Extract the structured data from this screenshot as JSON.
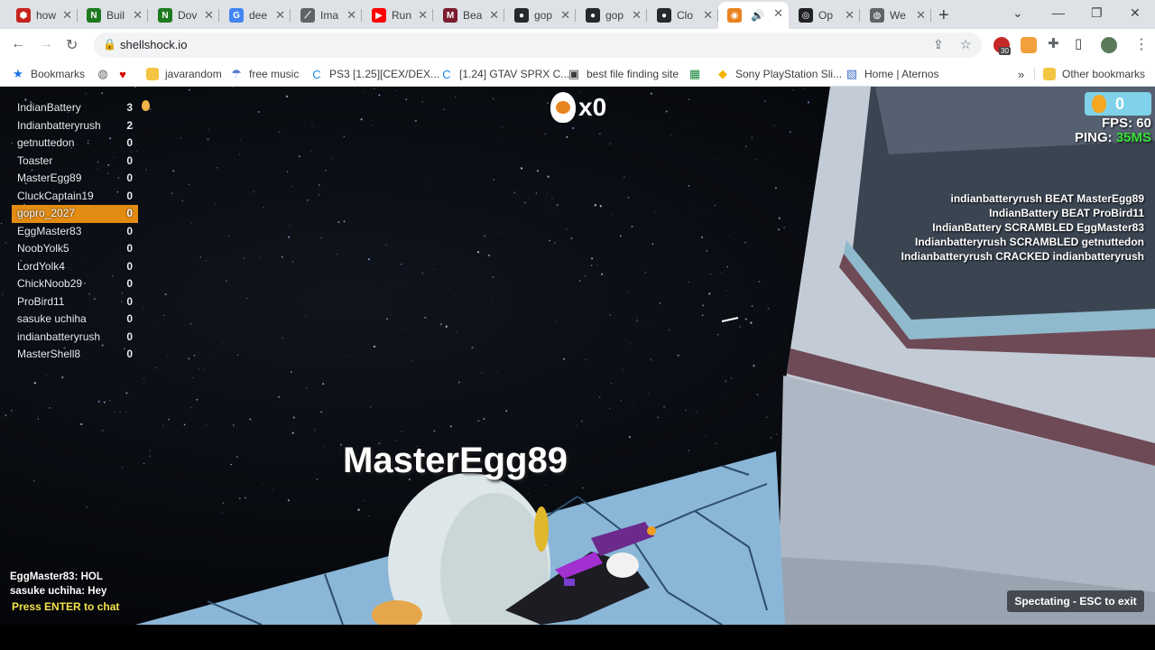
{
  "browser": {
    "tabs": [
      {
        "title": "how",
        "color": "#c5221f",
        "glyph": "⬢"
      },
      {
        "title": "Buil",
        "color": "#1f7a1f",
        "glyph": "N"
      },
      {
        "title": "Dov",
        "color": "#1f7a1f",
        "glyph": "N"
      },
      {
        "title": "dee",
        "color": "#4285f4",
        "glyph": "G"
      },
      {
        "title": "Ima",
        "color": "#5f6368",
        "glyph": "⟋"
      },
      {
        "title": "Run",
        "color": "#ff0000",
        "glyph": "▶"
      },
      {
        "title": "Bea",
        "color": "#7b1c2e",
        "glyph": "M"
      },
      {
        "title": "gop",
        "color": "#24292e",
        "glyph": "●"
      },
      {
        "title": "gop",
        "color": "#24292e",
        "glyph": "●"
      },
      {
        "title": "Clo",
        "color": "#24292e",
        "glyph": "●"
      },
      {
        "title": "",
        "color": "#e8841e",
        "glyph": "◉",
        "active": true
      },
      {
        "title": "Op",
        "color": "#202124",
        "glyph": "◎"
      },
      {
        "title": "We",
        "color": "#5f6368",
        "glyph": "◍"
      }
    ],
    "url": "shellshock.io",
    "extension_badge": "30"
  },
  "bookmarks": [
    {
      "label": "Bookmarks",
      "icon": "star-icon",
      "color": "#1a73e8"
    },
    {
      "label": "",
      "icon": "globe-icon",
      "color": "#5f6368"
    },
    {
      "label": "",
      "icon": "heart-icon",
      "color": "#d50000"
    },
    {
      "label": "javarandom",
      "icon": "folder-icon",
      "color": "#f4c542"
    },
    {
      "label": "free music",
      "icon": "parachute-icon",
      "color": "#5b7ccf"
    },
    {
      "label": "PS3 [1.25][CEX/DEX...",
      "icon": "c-icon",
      "color": "#1e88e5"
    },
    {
      "label": "[1.24] GTAV SPRX C...",
      "icon": "c-icon",
      "color": "#1e88e5"
    },
    {
      "label": "best file finding site",
      "icon": "briefcase-icon",
      "color": "#3c3c3c"
    },
    {
      "label": "",
      "icon": "sheet-icon",
      "color": "#1b8a3e"
    },
    {
      "label": "Sony PlayStation Sli...",
      "icon": "bag-icon",
      "color": "#f4b400"
    },
    {
      "label": "Home | Aternos",
      "icon": "cube-icon",
      "color": "#3d6ec9"
    },
    {
      "label": "Other bookmarks",
      "icon": "folder-icon",
      "color": "#f4c542"
    }
  ],
  "leaderboard": [
    {
      "name": "IndianBattery",
      "score": "3"
    },
    {
      "name": "Indianbatteryrush",
      "score": "2"
    },
    {
      "name": "getnuttedon",
      "score": "0"
    },
    {
      "name": "Toaster",
      "score": "0"
    },
    {
      "name": "MasterEgg89",
      "score": "0"
    },
    {
      "name": "CluckCaptain19",
      "score": "0"
    },
    {
      "name": "gopro_2027",
      "score": "0",
      "me": true
    },
    {
      "name": "EggMaster83",
      "score": "0"
    },
    {
      "name": "NoobYolk5",
      "score": "0"
    },
    {
      "name": "LordYolk4",
      "score": "0"
    },
    {
      "name": "ChickNoob29",
      "score": "0"
    },
    {
      "name": "ProBird11",
      "score": "0"
    },
    {
      "name": "sasuke uchiha",
      "score": "0"
    },
    {
      "name": "indianbatteryrush",
      "score": "0"
    },
    {
      "name": "MasterShell8",
      "score": "0"
    }
  ],
  "hud": {
    "kills": "x0",
    "eggs": "0",
    "fps_label": "FPS: 60",
    "ping_label": "PING: ",
    "ping_value": "35MS",
    "spectating_name": "MasterEgg89",
    "spectate_hint": "Spectating - ESC to exit"
  },
  "killfeed": [
    "indianbatteryrush BEAT MasterEgg89",
    "IndianBattery BEAT ProBird11",
    "IndianBattery SCRAMBLED EggMaster83",
    "Indianbatteryrush SCRAMBLED getnuttedon",
    "Indianbatteryrush CRACKED indianbatteryrush"
  ],
  "chat": {
    "lines": [
      "EggMaster83: HOL",
      "sasuke uchiha: Hey"
    ],
    "prompt": "Press ENTER to chat"
  }
}
